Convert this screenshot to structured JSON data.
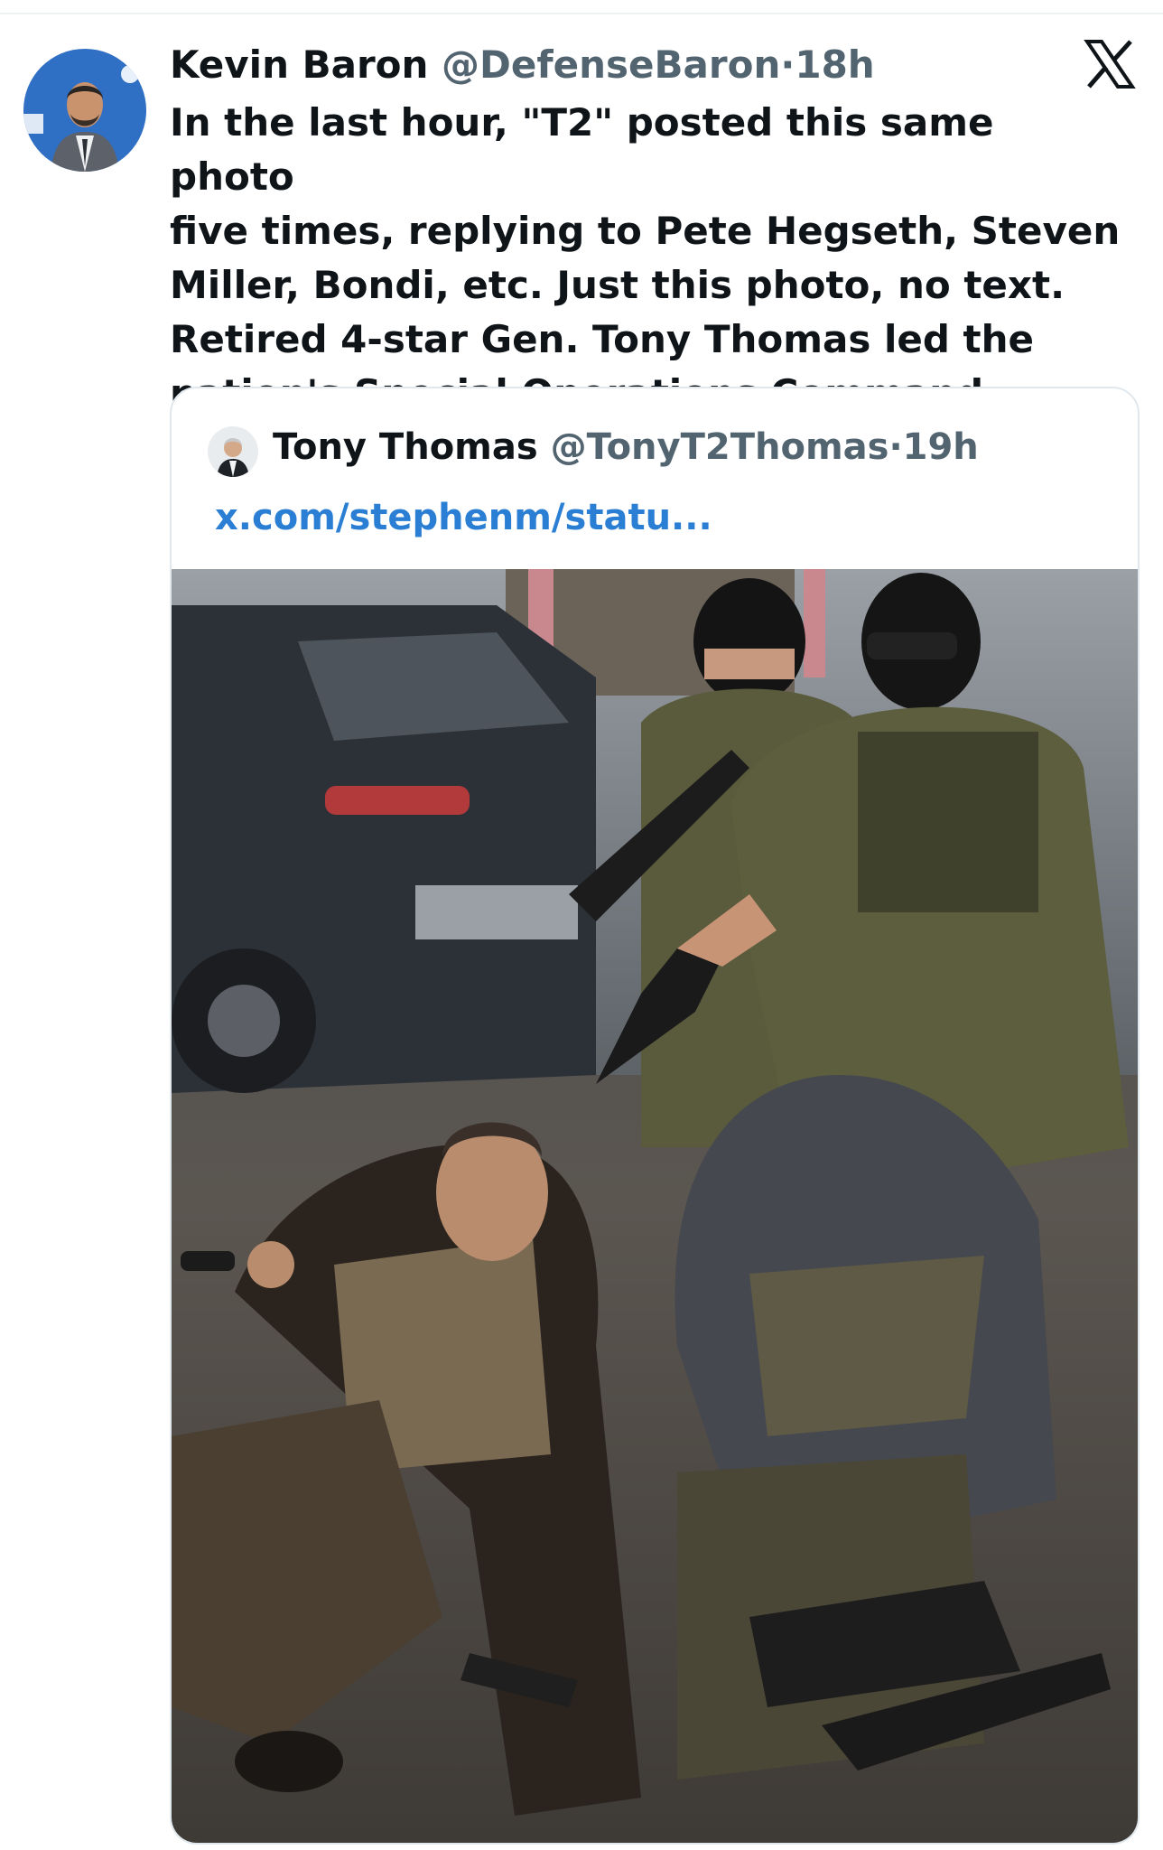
{
  "tweet": {
    "author_name": "Kevin Baron",
    "author_handle": "@DefenseBaron",
    "separator": "·",
    "time": "18h",
    "text": "In the last hour, \"T2\" posted this same photo\nfive times, replying to Pete Hegseth, Steven\nMiller, Bondi, etc. Just this photo, no text.\nRetired 4-star Gen. Tony Thomas led the\nnation's Special Operations Command.",
    "avatar_icon": "user-avatar",
    "platform_icon": "x-logo-icon"
  },
  "quoted_tweet": {
    "author_name": "Tony Thomas",
    "author_handle": "@TonyT2Thomas",
    "separator": "·",
    "time": "19h",
    "link_text": "x.com/stephenm/statu...",
    "avatar_icon": "user-avatar",
    "image_description_icon": "photo-armed-men-detaining-men"
  },
  "colors": {
    "text_primary": "#0f1419",
    "text_secondary": "#536471",
    "link": "#2a7fd4",
    "border": "#e1e8ed"
  }
}
